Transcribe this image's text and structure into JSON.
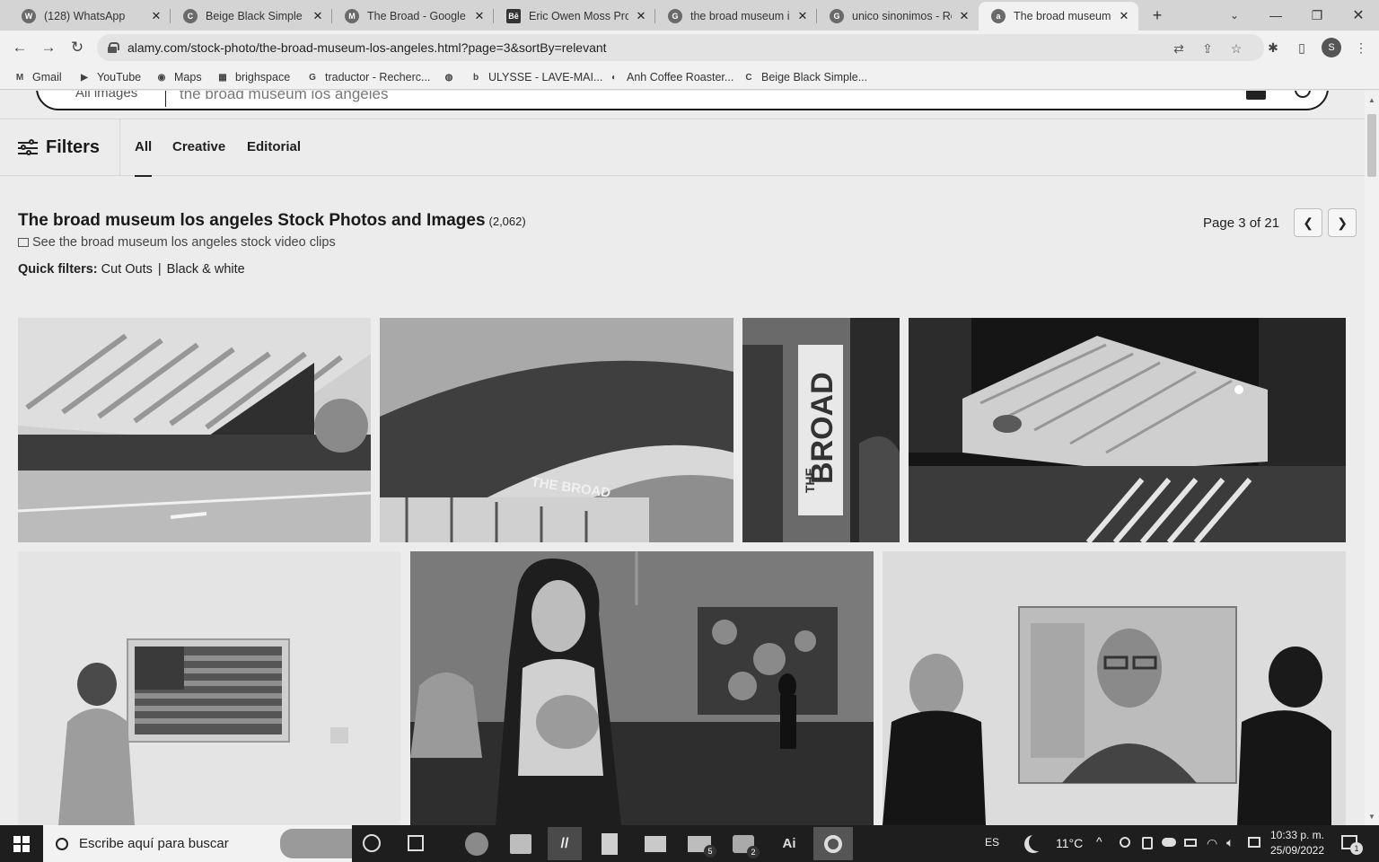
{
  "tabs": [
    {
      "label": "(128) WhatsApp",
      "fav": "W"
    },
    {
      "label": "Beige Black Simple Mi",
      "fav": "C"
    },
    {
      "label": "The Broad - Google M",
      "fav": "M"
    },
    {
      "label": "Eric Owen Moss Proye",
      "fav": "Bē"
    },
    {
      "label": "the broad museum in",
      "fav": "G"
    },
    {
      "label": "unico sinonimos - Rec",
      "fav": "G"
    },
    {
      "label": "The broad museum lo",
      "fav": "a"
    }
  ],
  "toolbar": {
    "url": "alamy.com/stock-photo/the-broad-museum-los-angeles.html?page=3&sortBy=relevant",
    "profile": "S"
  },
  "bookmarks": [
    {
      "label": "Gmail",
      "fav": "M"
    },
    {
      "label": "YouTube",
      "fav": "▶"
    },
    {
      "label": "Maps",
      "fav": "◉"
    },
    {
      "label": "brighspace",
      "fav": "▦"
    },
    {
      "label": "traductor - Recherc...",
      "fav": "G"
    },
    {
      "label": "",
      "fav": "◍"
    },
    {
      "label": "ULYSSE - LAVE-MAI...",
      "fav": "b"
    },
    {
      "label": "Anh Coffee Roaster...",
      "fav": "◐"
    },
    {
      "label": "Beige Black Simple...",
      "fav": "C"
    }
  ],
  "search": {
    "category": "All images",
    "query": "the broad museum los angeles"
  },
  "filters": {
    "label": "Filters",
    "tabs": [
      "All",
      "Creative",
      "Editorial"
    ]
  },
  "results": {
    "title": "The broad museum los angeles Stock Photos and Images",
    "count": "(2,062)",
    "video_link": "See the broad museum los angeles stock video clips",
    "quick_label": "Quick filters:",
    "quick": [
      "Cut Outs",
      "Black & white"
    ],
    "page_text": "Page 3 of 21"
  },
  "taskbar": {
    "search_placeholder": "Escribe aquí para buscar",
    "lang": "ES",
    "weather": "11°C",
    "time": "10:33 p. m.",
    "date": "25/09/2022",
    "mail_badge": "5",
    "teams_badge": "2",
    "notif_badge": "1",
    "ai_label": "Ai"
  }
}
